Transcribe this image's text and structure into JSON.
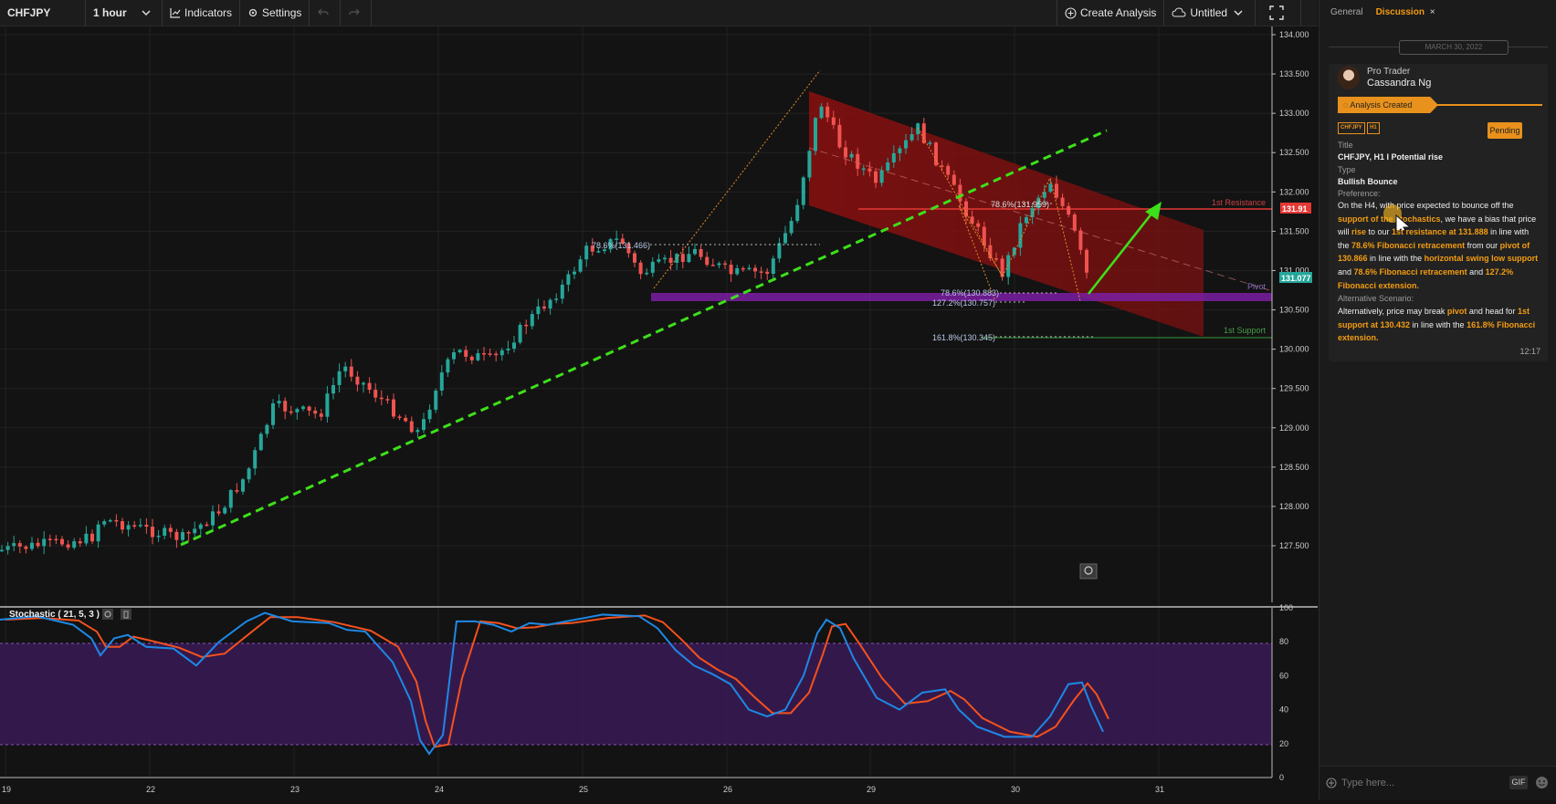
{
  "toolbar": {
    "symbol": "CHFJPY",
    "interval": "1 hour",
    "indicators": "Indicators",
    "settings": "Settings",
    "create_analysis": "Create Analysis",
    "layout_name": "Untitled"
  },
  "sidebar": {
    "tabs": [
      {
        "label": "General"
      },
      {
        "label": "Discussion"
      }
    ],
    "close_symbol": "×",
    "date": "MARCH 30, 2022",
    "post": {
      "role": "Pro Trader",
      "author": "Cassandra Ng",
      "banner": "Analysis Created",
      "tags": [
        "CHFJPY",
        "H1"
      ],
      "status": "Pending",
      "title_label": "Title",
      "title": "CHFJPY, H1 I Potential rise",
      "type_label": "Type",
      "type": "Bullish Bounce",
      "preference_label": "Preference:",
      "preference_segments": [
        {
          "t": "On the H4, with price expected to bounce off the ",
          "h": false
        },
        {
          "t": "support of the stochastics",
          "h": true
        },
        {
          "t": ", we have a bias that price will ",
          "h": false
        },
        {
          "t": "rise",
          "h": true
        },
        {
          "t": " to our ",
          "h": false
        },
        {
          "t": "1st resistance at 131.888",
          "h": true
        },
        {
          "t": " in line with the ",
          "h": false
        },
        {
          "t": "78.6% Fibonacci retracement",
          "h": true
        },
        {
          "t": " from our ",
          "h": false
        },
        {
          "t": "pivot of 130.866",
          "h": true
        },
        {
          "t": " in line with the ",
          "h": false
        },
        {
          "t": "horizontal swing low support",
          "h": true
        },
        {
          "t": " and ",
          "h": false
        },
        {
          "t": "78.6% Fibonacci retracement",
          "h": true
        },
        {
          "t": " and ",
          "h": false
        },
        {
          "t": "127.2% Fibonacci extension.",
          "h": true
        }
      ],
      "alt_label": "Alternative Scenario:",
      "alt_segments": [
        {
          "t": "Alternatively, price may break ",
          "h": false
        },
        {
          "t": "pivot",
          "h": true
        },
        {
          "t": " and head for ",
          "h": false
        },
        {
          "t": "1st support at 130.432",
          "h": true
        },
        {
          "t": " in line with the ",
          "h": false
        },
        {
          "t": "161.8% Fibonacci extension.",
          "h": true
        }
      ],
      "time": "12:17"
    },
    "input_placeholder": "Type here...",
    "gif_label": "GIF"
  },
  "chart": {
    "price_ticks": [
      "134.000",
      "133.500",
      "133.000",
      "132.500",
      "132.000",
      "131.500",
      "131.000",
      "130.500",
      "130.000",
      "129.500",
      "129.000",
      "128.500",
      "128.000",
      "127.500"
    ],
    "date_ticks": [
      "19",
      "22",
      "23",
      "24",
      "25",
      "26",
      "29",
      "30",
      "31"
    ],
    "current_price": "131.077",
    "resistance_price": "131.91",
    "resistance_label": "1st Resistance",
    "pivot_label": "Pivot",
    "support_label": "1st Support",
    "fib_labels": [
      "78.6%(131.466)",
      "78.6%(131.959)",
      "78.6%(130.883)",
      "127.2%(130.757)",
      "161.8%(130.345)"
    ],
    "stoch_title": "Stochastic ( 21, 5, 3 )",
    "stoch_ticks": [
      "100",
      "80",
      "60",
      "40",
      "20",
      "0"
    ],
    "colors": {
      "up": "#26a69a",
      "down": "#ef5350",
      "resistance": "#e53935",
      "pivot": "#7b1fa2",
      "support": "#2e7d32",
      "trend": "#3de01a",
      "k_line": "#1e88e5",
      "d_line": "#f4511e"
    }
  }
}
